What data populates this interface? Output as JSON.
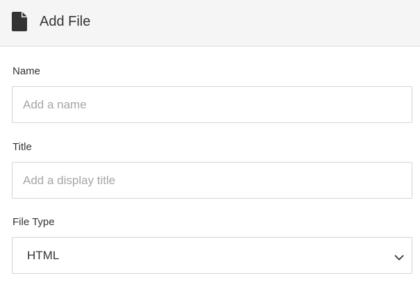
{
  "header": {
    "title": "Add File",
    "icon": "file-icon"
  },
  "fields": {
    "name": {
      "label": "Name",
      "value": "",
      "placeholder": "Add a name"
    },
    "title": {
      "label": "Title",
      "value": "",
      "placeholder": "Add a display title"
    },
    "file_type": {
      "label": "File Type",
      "selected": "HTML",
      "icon": "chevron-down-icon"
    }
  },
  "colors": {
    "header_bg": "#f5f5f5",
    "border": "#d4d4d4",
    "text": "#333333",
    "placeholder": "#a6a6a6"
  }
}
